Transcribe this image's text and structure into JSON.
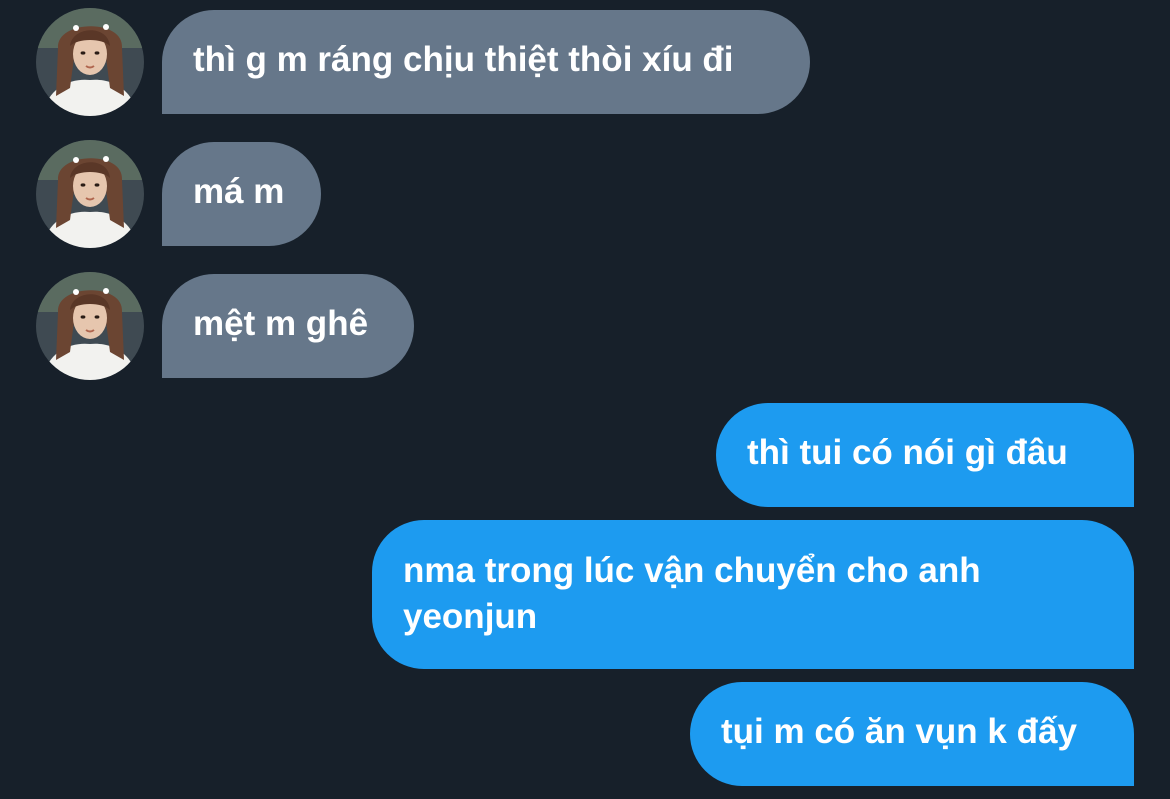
{
  "conversation": {
    "messages": [
      {
        "direction": "received",
        "text": "thì g m ráng chịu thiệt thòi xíu đi",
        "avatar_icon": "user-avatar-photo"
      },
      {
        "direction": "received",
        "text": "má m",
        "avatar_icon": "user-avatar-photo"
      },
      {
        "direction": "received",
        "text": "mệt m ghê",
        "avatar_icon": "user-avatar-photo"
      },
      {
        "direction": "sent",
        "text": "thì tui có nói gì đâu"
      },
      {
        "direction": "sent",
        "text": "nma trong lúc vận chuyển cho anh yeonjun"
      },
      {
        "direction": "sent",
        "text": "tụi m có ăn vụn k đấy"
      }
    ]
  },
  "colors": {
    "background": "#17202a",
    "received_bubble": "#66778a",
    "sent_bubble": "#1d9bf0",
    "text": "#ffffff"
  }
}
